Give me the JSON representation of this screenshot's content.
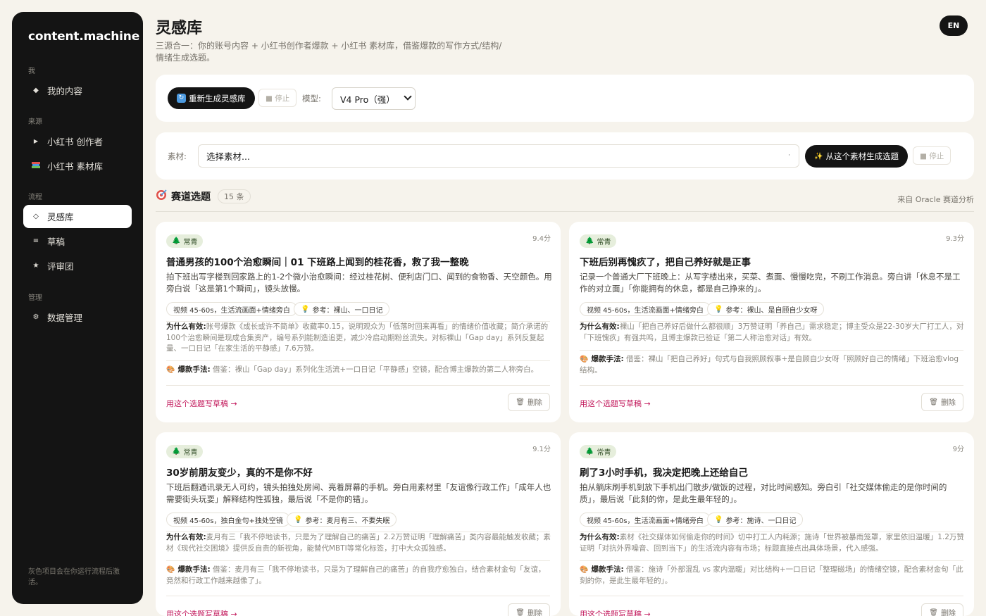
{
  "sidebar": {
    "brand": "content.machine",
    "sec_me": "我",
    "my_content": "我的内容",
    "sec_source": "来源",
    "xhs_creator": "小红书 创作者",
    "xhs_library": "小红书 素材库",
    "sec_flow": "流程",
    "inspiration": "灵感库",
    "drafts": "草稿",
    "review": "评审团",
    "sec_manage": "管理",
    "data_manage": "数据管理",
    "footer": "灰色项目会在你运行流程后激活。"
  },
  "header": {
    "title": "灵感库",
    "subtitle": "三源合一：你的账号内容 + 小红书创作者爆款 + 小红书 素材库，借鉴爆款的写作方式/结构/情绪生成选题。",
    "lang": "EN"
  },
  "toolbar": {
    "regen_label": "重新生成灵感库",
    "stop_label": "■ 停止",
    "model_label": "模型:",
    "model_value": "V4 Pro（强）"
  },
  "material": {
    "label": "素材:",
    "select_placeholder": "选择素材...",
    "gen_label": "从这个素材生成选题",
    "stop_label": "■ 停止"
  },
  "section": {
    "title": "赛道选题",
    "count": "15 条",
    "source": "来自 Oracle 赛道分析"
  },
  "cards": [
    {
      "tag": "常青",
      "score": "9.4分",
      "title": "普通男孩的100个治愈瞬间｜01 下班路上闻到的桂花香，救了我一整晚",
      "desc": "拍下班出写字楼到回家路上的1-2个微小治愈瞬间：经过桂花树、便利店门口、闻到的食物香、天空颜色。用旁白说「这是第1个瞬间」，镜头放慢。",
      "chip1": "视频 45-60s，生活流画面+情绪旁白",
      "chip2": "参考：裸山、一口日记",
      "why_label": "为什么有效:",
      "why": "账号爆款《成长或许不简单》收藏率0.15，说明观众为「低落时回来再看」的情绪价值收藏；简介承诺的100个治愈瞬间是现成合集资产，编号系列能制造追更，减少冷启动期粉丝流失。对标裸山「Gap day」系列反复起量、一口日记「在家生活的平静感」7.6万赞。",
      "boom_label": "爆款手法:",
      "boom": "借鉴：裸山「Gap day」系列化生活流+一口日记「平静感」空镜，配合博主爆款的第二人称旁白。",
      "use": "用这个选题写草稿 →",
      "del": "删除"
    },
    {
      "tag": "常青",
      "score": "9.3分",
      "title": "下班后别再愧疚了，把自己养好就是正事",
      "desc": "记录一个普通大厂下班晚上：从写字楼出来，买菜、煮面、慢慢吃完，不刷工作消息。旁白讲「休息不是工作的对立面」「你能拥有的休息，都是自己挣来的」。",
      "chip1": "视频 45-60s，生活流画面+情绪旁白",
      "chip2": "参考：裸山、是自顾自少女呀",
      "why_label": "为什么有效:",
      "why": "裸山「把自己养好后做什么都很顺」3万赞证明「养自己」需求稳定；博主受众是22-30岁大厂打工人，对「下班愧疚」有强共鸣，且博主爆款已验证「第二人称治愈对话」有效。",
      "boom_label": "爆款手法:",
      "boom": "借鉴：裸山「把自己养好」句式与自我照顾叙事+是自顾自少女呀「照顾好自己的情绪」下班治愈vlog结构。",
      "use": "用这个选题写草稿 →",
      "del": "删除"
    },
    {
      "tag": "常青",
      "score": "9.1分",
      "title": "30岁前朋友变少，真的不是你不好",
      "desc": "下班后翻通讯录无人可约，镜头拍独处房间、亮着屏幕的手机。旁白用素材里「友谊像行政工作」「成年人也需要街头玩耍」解释结构性孤独，最后说「不是你的错」。",
      "chip1": "视频 45-60s，独白金句+独处空镜",
      "chip2": "参考：麦月有三、不要失眠",
      "why_label": "为什么有效:",
      "why": "麦月有三「我不停地读书，只是为了理解自己的痛苦」2.2万赞证明「理解痛苦」类内容最能触发收藏；素材《现代社交困境》提供反自责的新视角，能替代MBTI等常化标签，打中大众孤独感。",
      "boom_label": "爆款手法:",
      "boom": "借鉴：麦月有三「我不停地读书，只是为了理解自己的痛苦」的自我疗愈独白，结合素材金句「友谊，竟然和行政工作越来越像了」。",
      "use": "用这个选题写草稿 →",
      "del": "删除"
    },
    {
      "tag": "常青",
      "score": "9分",
      "title": "刷了3小时手机，我决定把晚上还给自己",
      "desc": "拍从躺床刷手机到放下手机出门散步/做饭的过程，对比时间感知。旁白引「社交媒体偷走的是你时间的质」，最后说「此刻的你，是此生最年轻的」。",
      "chip1": "视频 45-60s，生活流画面+情绪旁白",
      "chip2": "参考：施诗、一口日记",
      "why_label": "为什么有效:",
      "why": "素材《社交媒体如何偷走你的时间》切中打工人内耗源；施诗「世界被暴雨笼罩，家里依旧温暖」1.2万赞证明「对抗外界噪音、回到当下」的生活流内容有市场；标题直接点出具体场景，代入感强。",
      "boom_label": "爆款手法:",
      "boom": "借鉴：施诗「外部混乱 vs 家内温暖」对比结构+一口日记「整理磁场」的情绪空镜，配合素材金句「此刻的你，是此生最年轻的」。",
      "use": "用这个选题写草稿 →",
      "del": "删除"
    }
  ]
}
